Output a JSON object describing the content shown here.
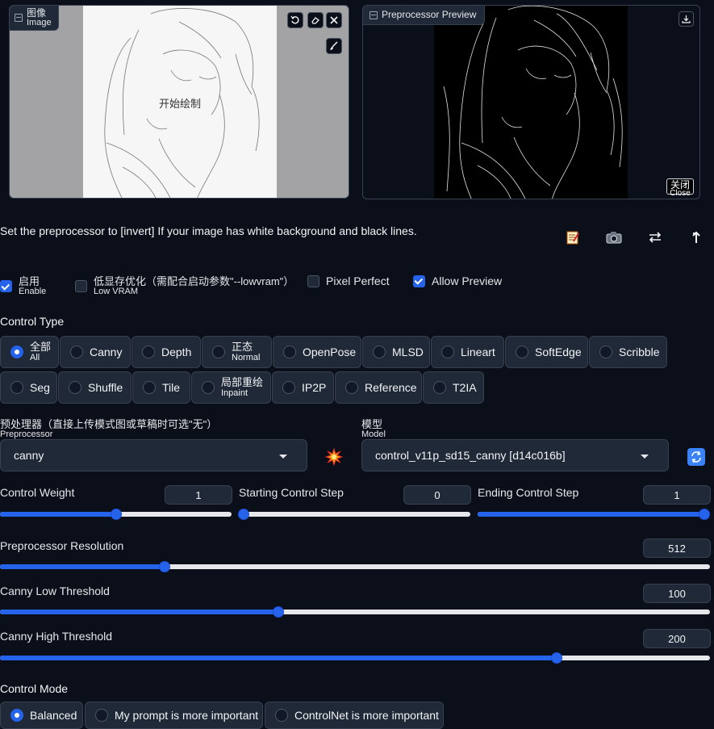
{
  "image_panel": {
    "label": "图像",
    "sub": "Image",
    "overlay_text": "开始绘制"
  },
  "preview_panel": {
    "label": "Preprocessor Preview",
    "close_label": "关闭",
    "close_sub": "Close"
  },
  "hint": "Set the preprocessor to [invert] If your image has white background and black lines.",
  "icons": [
    "memo-icon",
    "camera-icon",
    "swap-icon",
    "upload-arrow-icon"
  ],
  "checkboxes": {
    "enable": {
      "label": "启用",
      "sub": "Enable",
      "checked": true
    },
    "lowvram": {
      "label": "低显存优化（需配合启动参数\"--lowvram\"）",
      "sub": "Low VRAM",
      "checked": false
    },
    "pixel_perfect": {
      "label": "Pixel Perfect",
      "checked": false
    },
    "allow_preview": {
      "label": "Allow Preview",
      "checked": true
    }
  },
  "control_type": {
    "label": "Control Type",
    "options": [
      {
        "label": "全部",
        "sub": "All",
        "selected": true
      },
      {
        "label": "Canny"
      },
      {
        "label": "Depth"
      },
      {
        "label": "正态",
        "sub": "Normal"
      },
      {
        "label": "OpenPose"
      },
      {
        "label": "MLSD"
      },
      {
        "label": "Lineart"
      },
      {
        "label": "SoftEdge"
      },
      {
        "label": "Scribble"
      },
      {
        "label": "Seg"
      },
      {
        "label": "Shuffle"
      },
      {
        "label": "Tile"
      },
      {
        "label": "局部重绘",
        "sub": "Inpaint"
      },
      {
        "label": "IP2P"
      },
      {
        "label": "Reference"
      },
      {
        "label": "T2IA"
      }
    ]
  },
  "preprocessor": {
    "label": "预处理器（直接上传模式图或草稿时可选\"无\"）",
    "sub": "Preprocessor",
    "value": "canny"
  },
  "model": {
    "label": "模型",
    "sub": "Model",
    "value": "control_v11p_sd15_canny [d14c016b]"
  },
  "sliders": {
    "control_weight": {
      "label": "Control Weight",
      "value": "1",
      "fraction": 0.5
    },
    "starting_step": {
      "label": "Starting Control Step",
      "value": "0",
      "fraction": 0.0
    },
    "ending_step": {
      "label": "Ending Control Step",
      "value": "1",
      "fraction": 1.0
    },
    "preprocessor_resolution": {
      "label": "Preprocessor Resolution",
      "value": "512",
      "fraction": 0.232
    },
    "canny_low": {
      "label": "Canny Low Threshold",
      "value": "100",
      "fraction": 0.392
    },
    "canny_high": {
      "label": "Canny High Threshold",
      "value": "200",
      "fraction": 0.784
    }
  },
  "control_mode": {
    "label": "Control Mode",
    "options": [
      {
        "label": "Balanced",
        "selected": true
      },
      {
        "label": "My prompt is more important"
      },
      {
        "label": "ControlNet is more important"
      }
    ]
  },
  "colors": {
    "accent": "#2563eb",
    "background": "#0b0f19",
    "surface": "#1f2937",
    "border": "#374151"
  }
}
